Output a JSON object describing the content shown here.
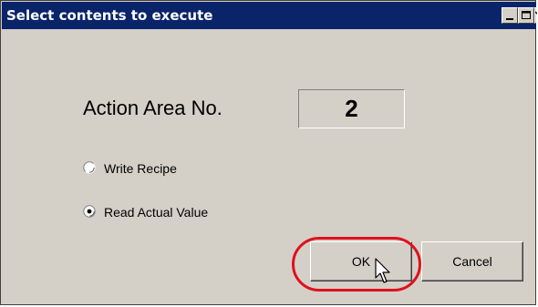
{
  "window": {
    "title": "Select contents to execute",
    "controls": [
      "minimize-icon",
      "maximize-icon",
      "close-icon"
    ]
  },
  "action_area": {
    "label": "Action Area No.",
    "value": "2"
  },
  "options": [
    {
      "label": "Write Recipe",
      "selected": false
    },
    {
      "label": "Read Actual Value",
      "selected": true
    }
  ],
  "buttons": {
    "ok": "OK",
    "cancel": "Cancel"
  },
  "colors": {
    "titlebar": "#0a246a",
    "dialog_bg": "#d4d0c8",
    "highlight": "#e0101c"
  }
}
